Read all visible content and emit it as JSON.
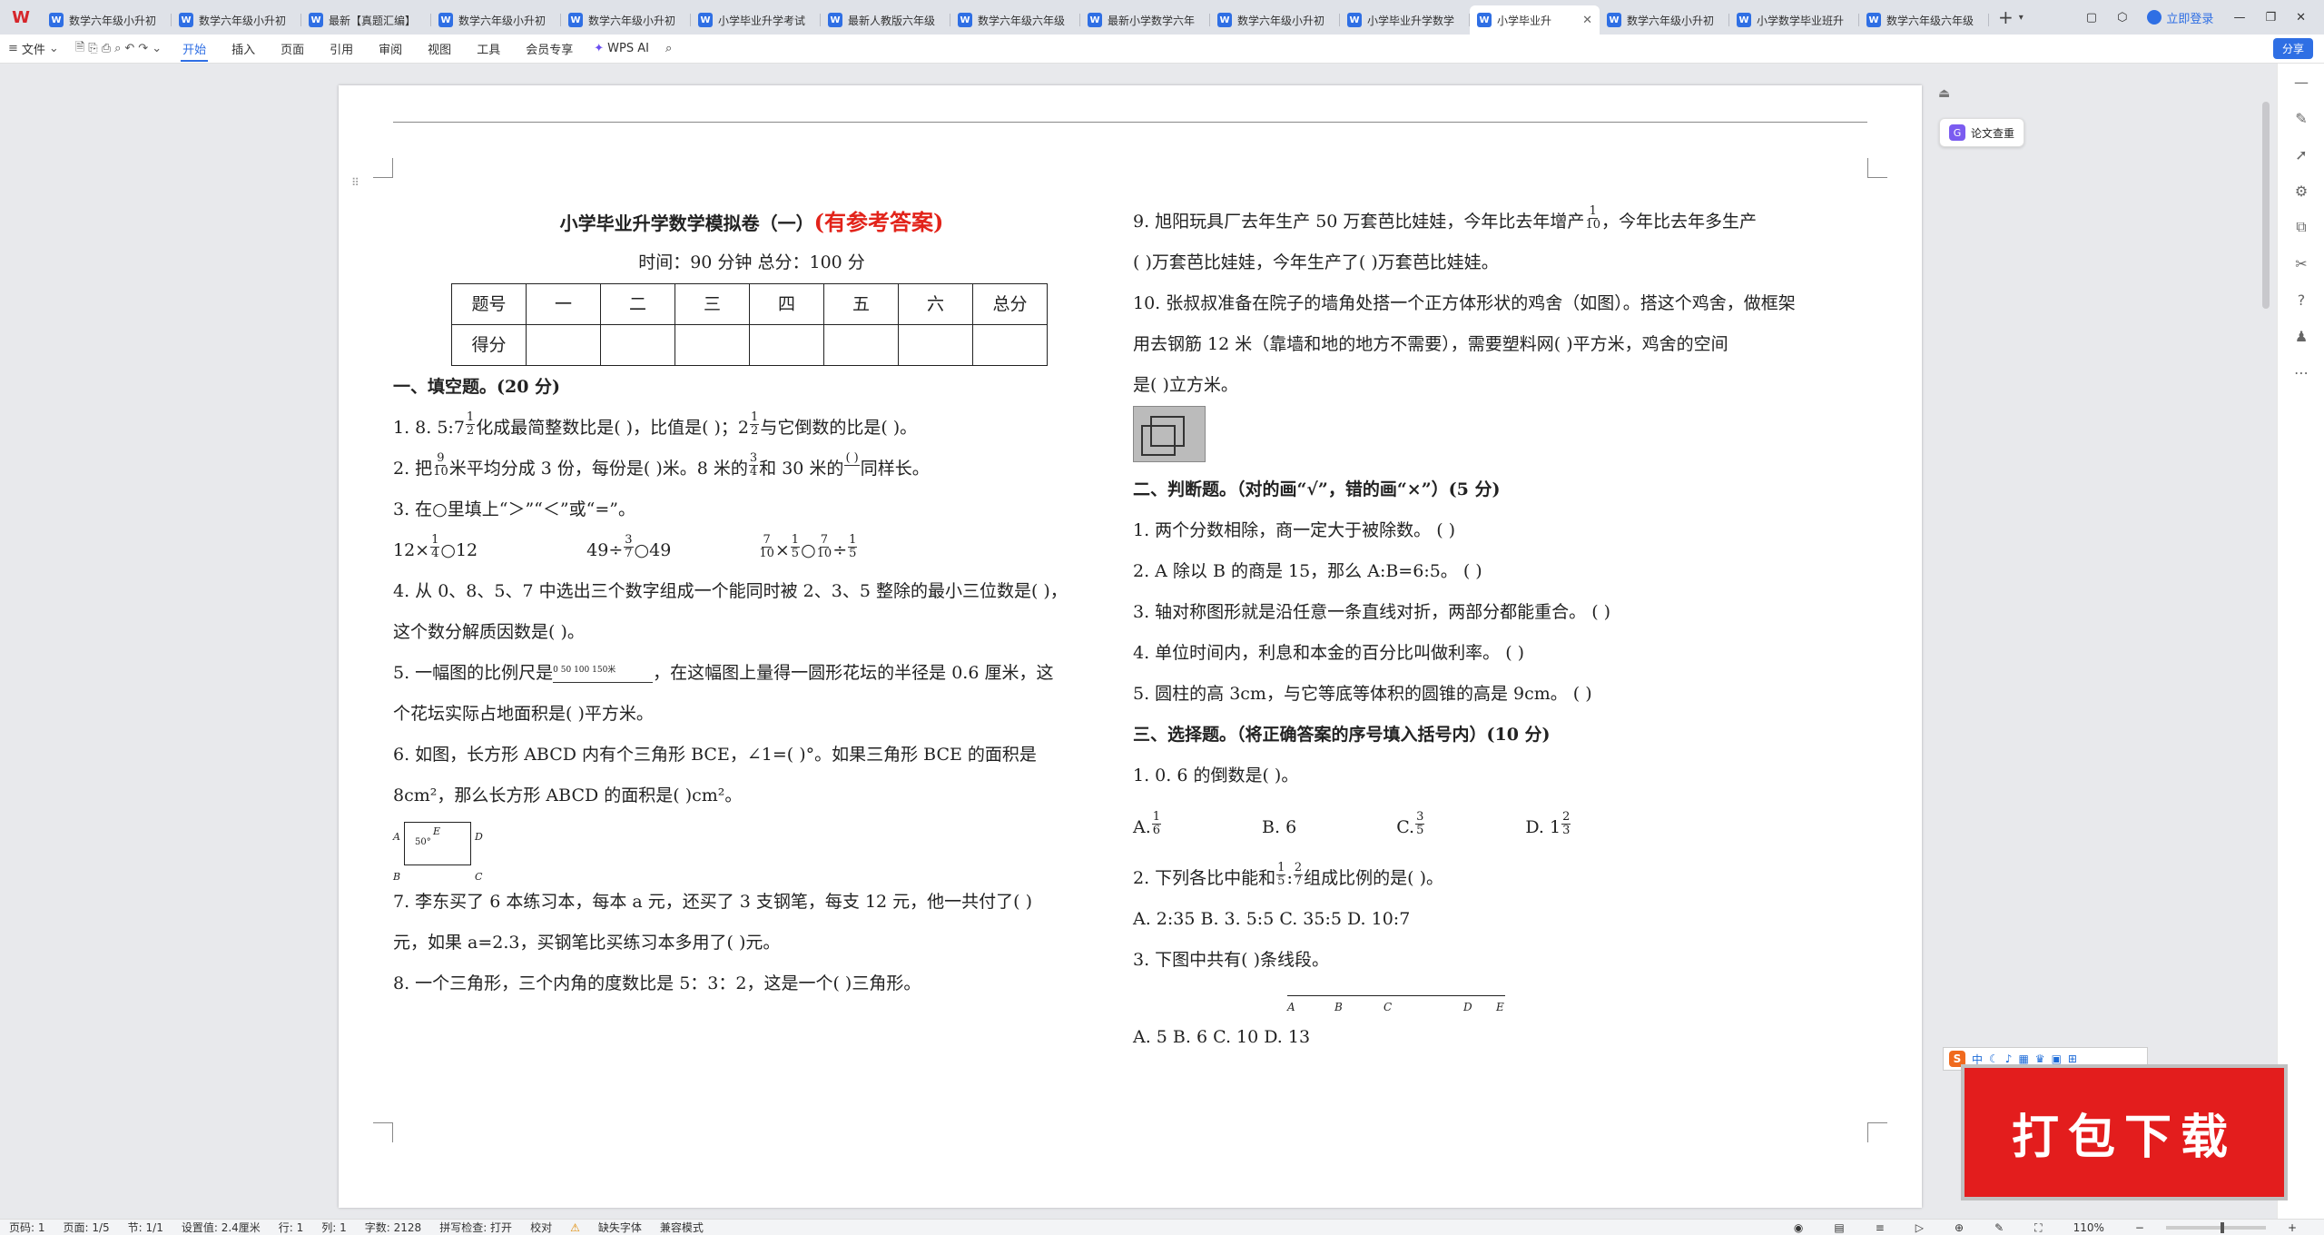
{
  "tabs": [
    {
      "label": "数学六年级小升初"
    },
    {
      "label": "数学六年级小升初"
    },
    {
      "label": "最新【真题汇编】"
    },
    {
      "label": "数学六年级小升初"
    },
    {
      "label": "数学六年级小升初"
    },
    {
      "label": "小学毕业升学考试"
    },
    {
      "label": "最新人教版六年级"
    },
    {
      "label": "数学六年级六年级"
    },
    {
      "label": "最新小学数学六年"
    },
    {
      "label": "数学六年级小升初"
    },
    {
      "label": "小学毕业升学数学"
    },
    {
      "label": "小学毕业升"
    },
    {
      "label": "数学六年级小升初"
    },
    {
      "label": "小学数学毕业班升"
    },
    {
      "label": "数学六年级六年级"
    }
  ],
  "login": "立即登录",
  "share": "分享",
  "toolbar": {
    "file": "文件",
    "wpsai": "WPS AI"
  },
  "menus": [
    "开始",
    "插入",
    "页面",
    "引用",
    "审阅",
    "视图",
    "工具",
    "会员专享"
  ],
  "check_label": "论文查重",
  "doc": {
    "title": "小学毕业升学数学模拟卷（一）",
    "title_red": "(有参考答案)",
    "subtitle": "时间：90 分钟        总分：100 分",
    "score_headers": [
      "题号",
      "一",
      "二",
      "三",
      "四",
      "五",
      "六",
      "总分"
    ],
    "score_row": [
      "得分",
      "",
      "",
      "",
      "",
      "",
      "",
      ""
    ],
    "s1": "一、填空题。(20 分)",
    "q1a": "1. 8. 5:7",
    "q1b": "化成最简整数比是(          )，比值是(       )；2",
    "q1c": "与它倒数的比是(          )。",
    "q2a": "2. 把",
    "q2b": "米平均分成 3 份，每份是(       )米。8 米的",
    "q2c": "和 30 米的",
    "q2d": "同样长。",
    "q3": "3. 在○里填上“＞”“＜”或“=”。",
    "q3a": "12×",
    "q3b": "○12",
    "q3c": "49÷",
    "q3d": "○49",
    "q3e": "○",
    "q4a": "4. 从 0、8、5、7 中选出三个数字组成一个能同时被 2、3、5 整除的最小三位数是(          )，",
    "q4b": "这个数分解质因数是(            )。",
    "q5a": "5. 一幅图的比例尺是",
    "q5b": "，在这幅图上量得一圆形花坛的半径是 0.6 厘米，这",
    "q5c": "个花坛实际占地面积是(          )平方米。",
    "q6a": "6. 如图，长方形 ABCD 内有个三角形 BCE，∠1=(          )°。如果三角形 BCE 的面积是",
    "q6b": "8cm²，那么长方形 ABCD 的面积是(          )cm²。",
    "q7a": "7. 李东买了 6 本练习本，每本 a 元，还买了 3 支钢笔，每支 12 元，他一共付了(          )",
    "q7b": "元，如果 a=2.3，买钢笔比买练习本多用了(          )元。",
    "q8": "8. 一个三角形，三个内角的度数比是 5：3：2，这是一个(          )三角形。",
    "q9a": "9. 旭阳玩具厂去年生产 50 万套芭比娃娃，今年比去年增产",
    "q9b": "，今年比去年多生产",
    "q9c": "(          )万套芭比娃娃，今年生产了(          )万套芭比娃娃。",
    "q10a": "10. 张叔叔准备在院子的墙角处搭一个正方体形状的鸡舍（如图）。搭这个鸡舍，做框架",
    "q10b": "用去钢筋 12 米（靠墙和地的地方不需要），需要塑料网(          )平方米，鸡舍的空间",
    "q10c": "是(          )立方米。",
    "s2": "二、判断题。（对的画“√”，错的画“×”）(5 分)",
    "j1": "1. 两个分数相除，商一定大于被除数。                  (      )",
    "j2": "2. A 除以 B 的商是 15，那么 A:B=6:5。                (      )",
    "j3": "3. 轴对称图形就是沿任意一条直线对折，两部分都能重合。   (      )",
    "j4": "4. 单位时间内，利息和本金的百分比叫做利率。              (      )",
    "j5": "5. 圆柱的高 3cm，与它等底等体积的圆锥的高是 9cm。        (      )",
    "s3": "三、选择题。（将正确答案的序号填入括号内）(10 分)",
    "c1": "1. 0. 6 的倒数是(        )。",
    "c1o": [
      "A.",
      "B. 6",
      "C.",
      "D. 1"
    ],
    "c2a": "2. 下列各比中能和",
    "c2b": "组成比例的是(       )。",
    "c2o": "A. 2:35            B. 3. 5:5            C. 35:5            D. 10:7",
    "c3": "3. 下图中共有(        )条线段。",
    "c3o": "A. 5            B. 6            C. 10            D. 13",
    "seg_labels": [
      "A",
      "B",
      "C",
      "D",
      "E"
    ],
    "fig_labels": [
      "A",
      "E",
      "D",
      "B",
      "C",
      "50°"
    ],
    "ruler_labels": "0  50  100  150米"
  },
  "fractions": {
    "half": [
      "1",
      "2"
    ],
    "nine_ten": [
      "9",
      "10"
    ],
    "three_four": [
      "3",
      "4"
    ],
    "blank": [
      "(      )",
      ""
    ],
    "one_four": [
      "1",
      "4"
    ],
    "three_seven": [
      "3",
      "7"
    ],
    "seven_ten": [
      "7",
      "10"
    ],
    "one_five": [
      "1",
      "5"
    ],
    "one_ten": [
      "1",
      "10"
    ],
    "one_six": [
      "1",
      "6"
    ],
    "three_five": [
      "3",
      "5"
    ],
    "two_three": [
      "2",
      "3"
    ],
    "two_seven": [
      "2",
      "7"
    ]
  },
  "ime_label": "中",
  "banner": "打包下载",
  "status": {
    "page": "页码: 1",
    "pages": "页面: 1/5",
    "section": "节: 1/1",
    "setting": "设置值: 2.4厘米",
    "row": "行: 1",
    "col": "列: 1",
    "words": "字数: 2128",
    "spell": "拼写检查: 打开",
    "proof": "校对",
    "font_missing": "缺失字体",
    "compat": "兼容模式",
    "zoom": "110%"
  }
}
